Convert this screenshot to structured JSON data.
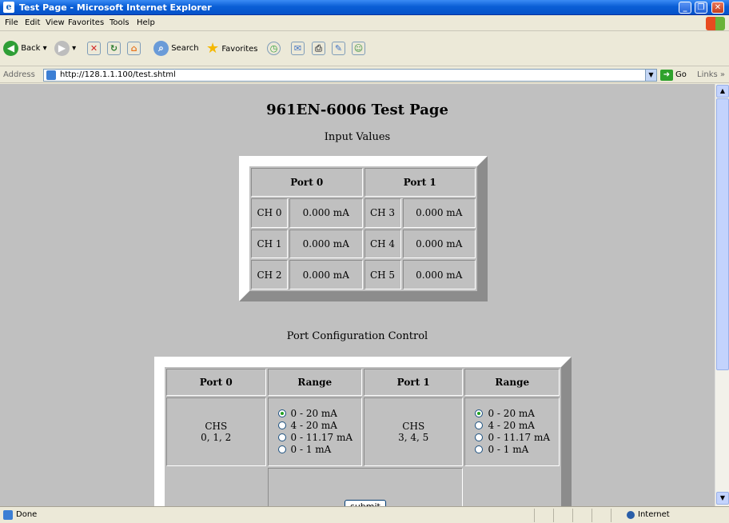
{
  "window": {
    "title": "Test Page - Microsoft Internet Explorer"
  },
  "menu": [
    "File",
    "Edit",
    "View",
    "Favorites",
    "Tools",
    "Help"
  ],
  "toolbar": {
    "back": "Back",
    "search": "Search",
    "favorites": "Favorites"
  },
  "address": {
    "label": "Address",
    "url": "http://128.1.1.100/test.shtml",
    "go": "Go",
    "links": "Links"
  },
  "status": {
    "text": "Done",
    "zone": "Internet"
  },
  "page": {
    "title": "961EN-6006 Test Page",
    "input_heading": "Input Values",
    "input_ports": [
      "Port 0",
      "Port 1"
    ],
    "input_rows": [
      {
        "ch_a": "CH 0",
        "val_a": "0.000 mA",
        "ch_b": "CH 3",
        "val_b": "0.000 mA"
      },
      {
        "ch_a": "CH 1",
        "val_a": "0.000 mA",
        "ch_b": "CH 4",
        "val_b": "0.000 mA"
      },
      {
        "ch_a": "CH 2",
        "val_a": "0.000 mA",
        "ch_b": "CH 5",
        "val_b": "0.000 mA"
      }
    ],
    "config_heading": "Port Configuration Control",
    "config_headers": [
      "Port 0",
      "Range",
      "Port 1",
      "Range"
    ],
    "port0_chs": [
      "CHS",
      "0, 1, 2"
    ],
    "port1_chs": [
      "CHS",
      "3, 4, 5"
    ],
    "ranges": [
      "0 - 20 mA",
      "4 - 20 mA",
      "0 - 11.17 mA",
      "0 - 1 mA"
    ],
    "port0_selected": "0 - 20 mA",
    "port1_selected": "0 - 20 mA",
    "submit": "submit"
  }
}
